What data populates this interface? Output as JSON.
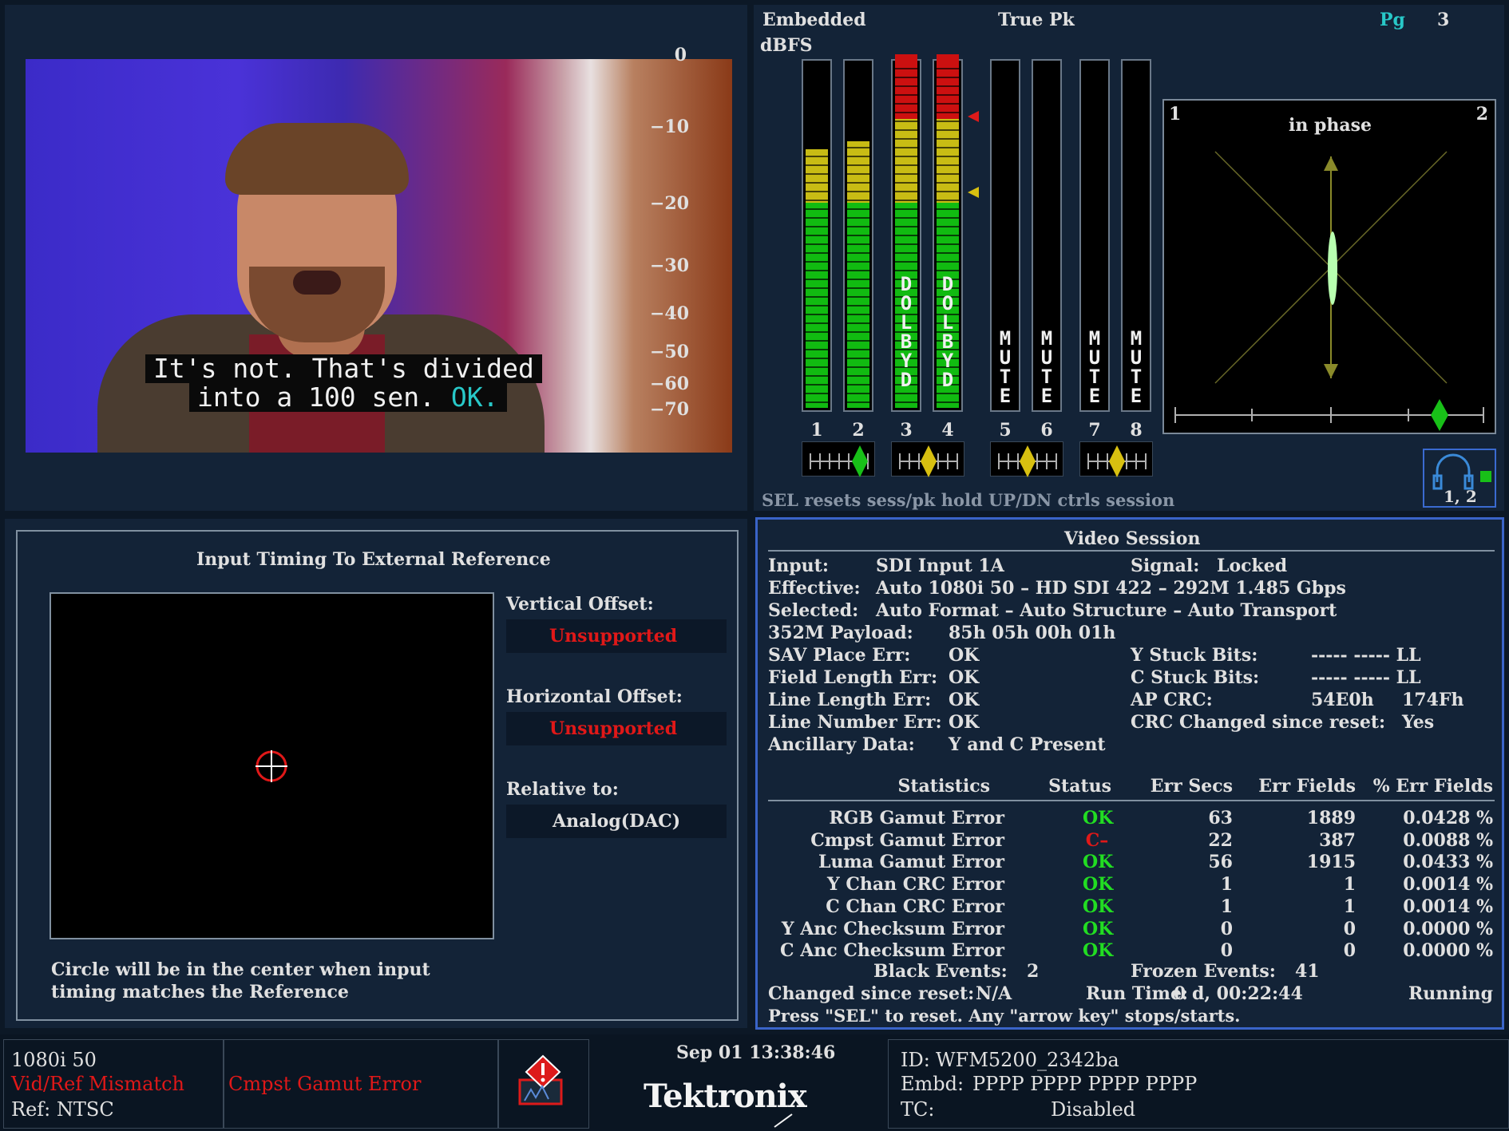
{
  "video": {
    "caption_line1": "It's not. That's divided",
    "caption_line2": "into a 100 sen.",
    "caption_ok": "OK."
  },
  "audio": {
    "source": "Embedded",
    "unit": "dBFS",
    "mode": "True Pk",
    "page_label": "Pg",
    "page_number": "3",
    "scale": [
      "0",
      "−10",
      "−20",
      "−30",
      "−40",
      "−50",
      "−60",
      "−70"
    ],
    "channels": [
      "1",
      "2",
      "3",
      "4",
      "5",
      "6",
      "7",
      "8"
    ],
    "dolby_label": "DOLBY D",
    "mute_label": "MUTE",
    "levels_dbfs": [
      -13,
      -12,
      0,
      0,
      null,
      null,
      null,
      null
    ],
    "lissajous_left": "1",
    "lissajous_right": "2",
    "phase_label": "in phase",
    "headphone_channels": "1, 2",
    "footer_hint": "SEL resets sess/pk hold  UP/DN ctrls session",
    "colors": {
      "green": "#11bb11",
      "yellow": "#c8bc14",
      "red": "#cc1010"
    }
  },
  "timing": {
    "title": "Input Timing To External Reference",
    "vertical_label": "Vertical Offset:",
    "vertical_value": "Unsupported",
    "horizontal_label": "Horizontal Offset:",
    "horizontal_value": "Unsupported",
    "relative_label": "Relative to:",
    "relative_value": "Analog(DAC)",
    "note_line1": "Circle will be in the center when input",
    "note_line2": "timing matches the Reference"
  },
  "session": {
    "title": "Video Session",
    "input_label": "Input:",
    "input_value": "SDI Input 1A",
    "signal_label": "Signal:",
    "signal_value": "Locked",
    "effective_label": "Effective:",
    "effective_value": "Auto 1080i 50 – HD SDI 422 – 292M 1.485 Gbps",
    "selected_label": "Selected:",
    "selected_value": "Auto Format – Auto Structure – Auto Transport",
    "payload_label": "352M Payload:",
    "payload_value": "85h 05h 00h 01h",
    "sav_label": "SAV Place Err:",
    "sav_value": "OK",
    "field_label": "Field Length Err:",
    "field_value": "OK",
    "line_label": "Line Length Err:",
    "line_value": "OK",
    "linenum_label": "Line Number Err:",
    "linenum_value": "OK",
    "ancillary_label": "Ancillary Data:",
    "ancillary_value": "Y and C Present",
    "ystuck_label": "Y Stuck Bits:",
    "ystuck_value": "----- ----- LL",
    "cstuck_label": "C Stuck Bits:",
    "cstuck_value": "----- ----- LL",
    "apcrc_label": "AP CRC:",
    "apcrc_value1": "54E0h",
    "apcrc_value2": "174Fh",
    "crcchanged_label": "CRC Changed since reset:",
    "crcchanged_value": "Yes",
    "stats_headers": [
      "Statistics",
      "Status",
      "Err Secs",
      "Err Fields",
      "% Err Fields"
    ],
    "stats_rows": [
      {
        "name": "RGB Gamut Error",
        "status": "OK",
        "secs": "63",
        "fields": "1889",
        "pct": "0.0428 %"
      },
      {
        "name": "Cmpst Gamut Error",
        "status": "C–",
        "secs": "22",
        "fields": "387",
        "pct": "0.0088 %"
      },
      {
        "name": "Luma Gamut Error",
        "status": "OK",
        "secs": "56",
        "fields": "1915",
        "pct": "0.0433 %"
      },
      {
        "name": "Y Chan CRC Error",
        "status": "OK",
        "secs": "1",
        "fields": "1",
        "pct": "0.0014 %"
      },
      {
        "name": "C Chan CRC Error",
        "status": "OK",
        "secs": "1",
        "fields": "1",
        "pct": "0.0014 %"
      },
      {
        "name": "Y Anc Checksum Error",
        "status": "OK",
        "secs": "0",
        "fields": "0",
        "pct": "0.0000 %"
      },
      {
        "name": "C Anc Checksum Error",
        "status": "OK",
        "secs": "0",
        "fields": "0",
        "pct": "0.0000 %"
      }
    ],
    "black_label": "Black Events:",
    "black_value": "2",
    "frozen_label": "Frozen Events:",
    "frozen_value": "41",
    "changed_label": "Changed since reset:",
    "changed_value": "N/A",
    "runtime_label": "Run Time:",
    "runtime_value": "0 d, 00:22:44",
    "state": "Running",
    "hint": "Press \"SEL\" to reset.   Any \"arrow key\" stops/starts."
  },
  "status_bar": {
    "format": "1080i 50",
    "mismatch": "Vid/Ref Mismatch",
    "ref": "Ref: NTSC",
    "alarm": "Cmpst Gamut Error",
    "datetime": "Sep 01 13:38:46",
    "brand": "Tektronix",
    "id_label": "ID:",
    "id_value": "WFM5200_2342ba",
    "embd_label": "Embd:",
    "embd_value": "PPPP PPPP PPPP PPPP",
    "tc_label": "TC:",
    "tc_value": "Disabled"
  }
}
